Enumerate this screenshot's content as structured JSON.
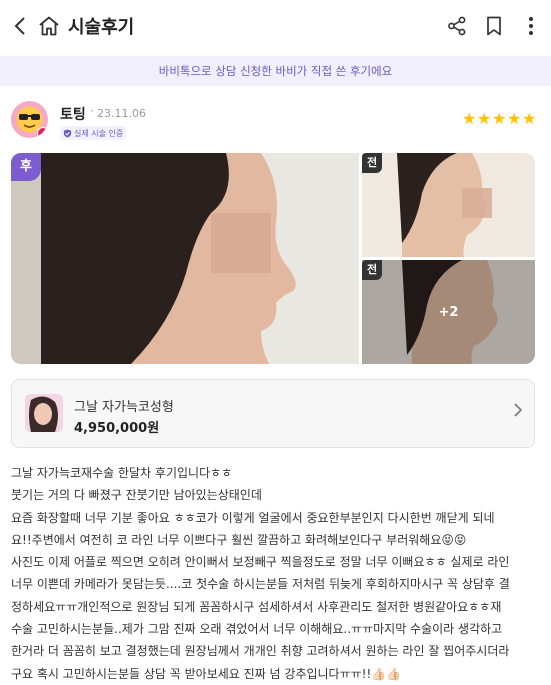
{
  "header": {
    "title": "시술후기",
    "icons": [
      "back-icon",
      "home-icon",
      "share-icon",
      "bookmark-icon",
      "more-icon"
    ]
  },
  "banner": {
    "text": "바비톡으로 상담 신청한 바비가 직접 쓴 후기에요"
  },
  "review": {
    "author": "토팅",
    "separator": "·",
    "date": "23.11.06",
    "badge": "실제 시술 인증",
    "rating": 5,
    "stars": "★★★★★",
    "photo_tags": {
      "after": "후",
      "before1": "전",
      "before2": "전"
    },
    "more_photos": "+2"
  },
  "product": {
    "name": "그날 자가늑코성형",
    "price": "4,950,000원"
  },
  "body_lines": [
    "그날 자가늑코재수술 한달차 후기입니다ㅎㅎ",
    "붓기는 거의 다 빠졌구 잔붓기만 남아있는상태인데",
    "요즘 화장할때 너무 기분 좋아요 ㅎㅎ코가 이렇게 얼굴에서 중요한부분인지 다시한번 깨닫게 되네",
    "요!!주변에서 여전히 코 라인 너무 이쁘다구 훨씬 깔끔하고 화려해보인다구 부러워해요😝😝",
    "사진도 이제 어플로 찍으면 오히려 안이뻐서 보정빼구 찍을정도로 정말 너무 이뻐요ㅎㅎ 실제로 라인",
    "너무 이쁜데 카메라가 못담는듯....코 첫수술 하시는분들 저처럼 뒤늦게 후회하지마시구 꼭 상담후 결",
    "정하세요ㅠㅠ개인적으로 원장님 되게 꼼꼼하시구 섬세하셔서 사후관리도 철저한 병원같아요ㅎㅎ재",
    "수술 고민하시는분들..제가 그맘 진짜 오래 겪었어서 너무 이해해요..ㅠㅠ마지막 수술이라 생각하고",
    "한거라 더 꼼꼼히 보고 결정했는데 원장님께서 개개인 취향 고려하셔서 원하는 라인 잘 찝어주시더라",
    "구요 혹시 고민하시는분들 상담 꼭 받아보세요 진짜 넘 강추입니다ㅠㅠ!!👍🏻👍🏻"
  ],
  "colors": {
    "accent": "#7d5ccf",
    "banner_bg": "#f1effb",
    "star": "#ffc107"
  }
}
